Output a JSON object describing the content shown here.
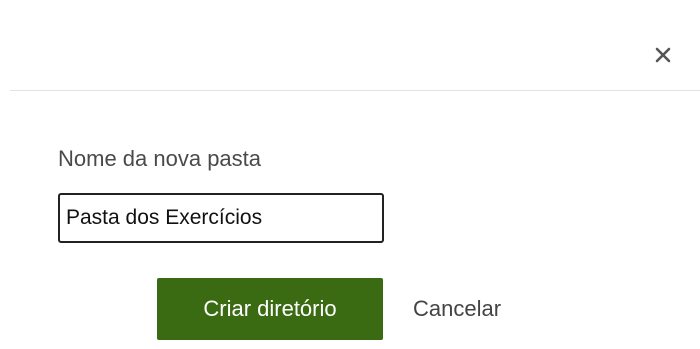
{
  "dialog": {
    "close_icon": "close-icon",
    "field_label": "Nome da nova pasta",
    "folder_name_value": "Pasta dos Exercícios",
    "create_button_label": "Criar diretório",
    "cancel_button_label": "Cancelar",
    "colors": {
      "primary_button": "#3a6b12",
      "primary_button_text": "#ffffff",
      "divider": "#e3e3e3",
      "close_icon": "#555555"
    }
  }
}
